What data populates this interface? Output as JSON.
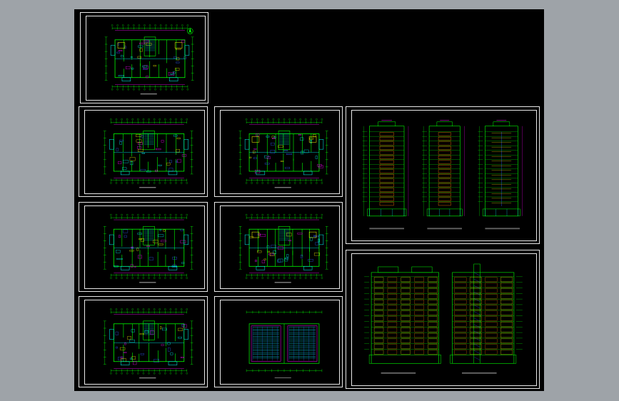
{
  "app": {
    "view_background": "#9ea3a8",
    "canvas_background": "#000000"
  },
  "colors": {
    "frame": "#e8e8e8",
    "wall": "#00ff00",
    "dimension": "#ff00ff",
    "axis": "#00ffff",
    "accent_yellow": "#ffff00",
    "accent_orange": "#ff8000",
    "accent_blue": "#3060ff"
  },
  "sheets": [
    {
      "id": "floor-plan-1",
      "kind": "plan",
      "title": "",
      "has_north_arrow": true
    },
    {
      "id": "floor-plan-2",
      "kind": "plan",
      "title": ""
    },
    {
      "id": "floor-plan-3",
      "kind": "plan",
      "title": ""
    },
    {
      "id": "floor-plan-4",
      "kind": "plan",
      "title": ""
    },
    {
      "id": "floor-plan-5",
      "kind": "plan",
      "title": ""
    },
    {
      "id": "floor-plan-6",
      "kind": "plan",
      "title": ""
    },
    {
      "id": "roof-plan",
      "kind": "plan",
      "title": ""
    },
    {
      "id": "elevation-sheet-side",
      "kind": "elevations",
      "title": ""
    },
    {
      "id": "elevation-sheet-front",
      "kind": "elevations",
      "title": ""
    }
  ]
}
